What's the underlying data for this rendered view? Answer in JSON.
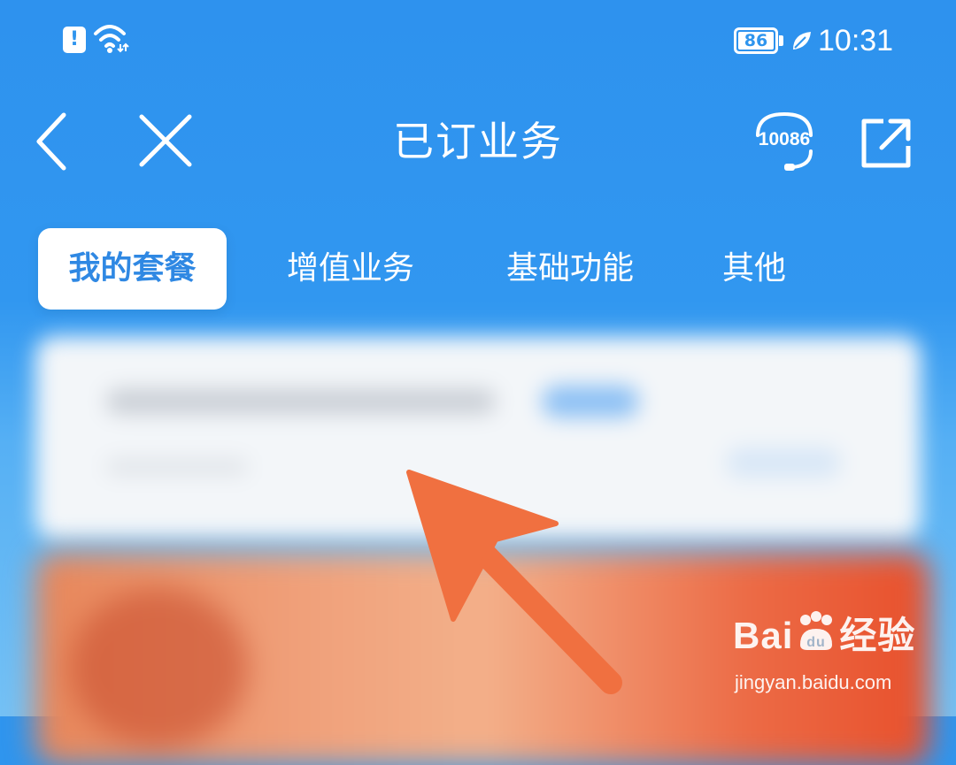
{
  "status_bar": {
    "battery": "86",
    "time": "10:31"
  },
  "header": {
    "title": "已订业务",
    "service_number": "10086"
  },
  "tabs": [
    {
      "label": "我的套餐",
      "active": true
    },
    {
      "label": "增值业务",
      "active": false
    },
    {
      "label": "基础功能",
      "active": false
    },
    {
      "label": "其他",
      "active": false
    }
  ],
  "watermark": {
    "logo": "Bai du 经验",
    "url": "jingyan.baidu.com"
  },
  "colors": {
    "primary_blue": "#2f95ee",
    "active_tab_text": "#2f88e3",
    "arrow": "#f07040"
  }
}
